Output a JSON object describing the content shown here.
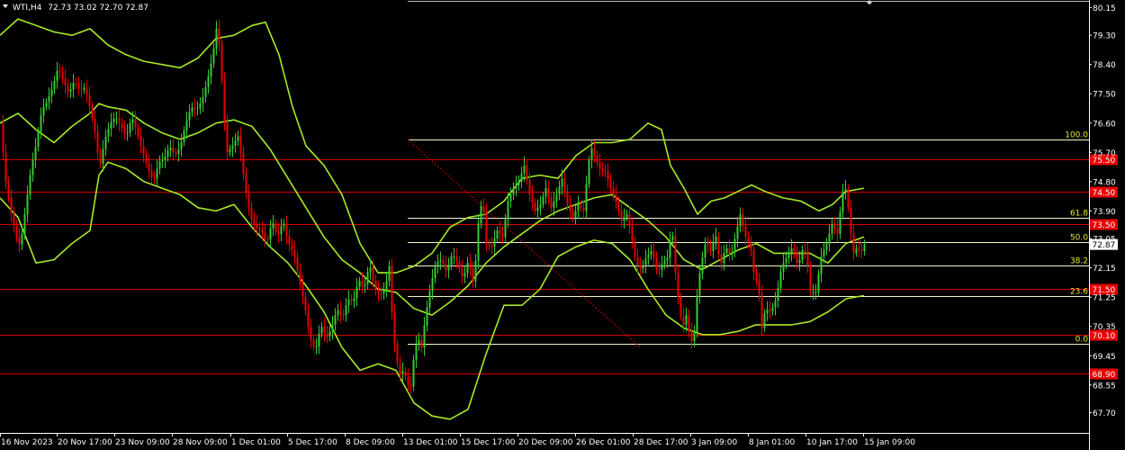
{
  "chart_data": {
    "type": "candlestick",
    "symbol_label": "WTI,H4",
    "ohlc_readout": "72.73 73.02 72.70 72.87",
    "ylim": [
      67.3,
      80.3
    ],
    "y_ticks": [
      "80.15",
      "79.30",
      "78.40",
      "77.50",
      "76.60",
      "75.70",
      "74.80",
      "73.90",
      "73.05",
      "72.15",
      "71.25",
      "70.35",
      "69.45",
      "68.55",
      "67.70"
    ],
    "x_ticks": [
      "16 Nov 2023",
      "20 Nov 17:00",
      "23 Nov 09:00",
      "28 Nov 09:00",
      "1 Dec 01:00",
      "5 Dec 17:00",
      "8 Dec 09:00",
      "13 Dec 01:00",
      "15 Dec 17:00",
      "20 Dec 09:00",
      "26 Dec 01:00",
      "28 Dec 17:00",
      "3 Jan 09:00",
      "8 Jan 01:00",
      "10 Jan 17:00",
      "15 Jan 09:00"
    ],
    "current_price": "72.87",
    "horizontal_levels": [
      "75.50",
      "74.50",
      "73.50",
      "71.50",
      "70.10",
      "68.90"
    ],
    "fibonacci": [
      {
        "label": "100.0",
        "price": 76.09
      },
      {
        "label": "61.8",
        "price": 73.69
      },
      {
        "label": "50.0",
        "price": 72.95
      },
      {
        "label": "38.2",
        "price": 72.21
      },
      {
        "label": "23.6",
        "price": 71.29
      },
      {
        "label": "0.0",
        "price": 69.81
      }
    ],
    "price_path": [
      [
        0,
        76.6
      ],
      [
        6,
        74.8
      ],
      [
        12,
        73.8
      ],
      [
        18,
        73.1
      ],
      [
        22,
        72.8
      ],
      [
        28,
        74.0
      ],
      [
        34,
        75.2
      ],
      [
        40,
        76.0
      ],
      [
        46,
        77.0
      ],
      [
        52,
        77.3
      ],
      [
        58,
        77.7
      ],
      [
        64,
        78.3
      ],
      [
        70,
        77.9
      ],
      [
        76,
        77.5
      ],
      [
        82,
        77.9
      ],
      [
        88,
        77.6
      ],
      [
        94,
        77.7
      ],
      [
        100,
        77.0
      ],
      [
        106,
        76.2
      ],
      [
        110,
        75.2
      ],
      [
        116,
        76.1
      ],
      [
        122,
        76.6
      ],
      [
        128,
        76.8
      ],
      [
        134,
        76.5
      ],
      [
        140,
        76.2
      ],
      [
        146,
        76.8
      ],
      [
        152,
        76.3
      ],
      [
        158,
        75.7
      ],
      [
        164,
        75.2
      ],
      [
        170,
        74.8
      ],
      [
        176,
        75.4
      ],
      [
        182,
        75.5
      ],
      [
        188,
        75.9
      ],
      [
        194,
        75.6
      ],
      [
        200,
        75.9
      ],
      [
        206,
        76.6
      ],
      [
        212,
        77.1
      ],
      [
        218,
        77.0
      ],
      [
        224,
        77.3
      ],
      [
        230,
        77.9
      ],
      [
        236,
        78.7
      ],
      [
        240,
        79.5
      ],
      [
        244,
        78.9
      ],
      [
        248,
        76.9
      ],
      [
        252,
        75.7
      ],
      [
        258,
        75.9
      ],
      [
        264,
        76.2
      ],
      [
        268,
        75.5
      ],
      [
        272,
        74.6
      ],
      [
        278,
        73.7
      ],
      [
        284,
        73.4
      ],
      [
        290,
        73.3
      ],
      [
        296,
        72.9
      ],
      [
        302,
        73.6
      ],
      [
        308,
        73.1
      ],
      [
        314,
        73.6
      ],
      [
        320,
        72.9
      ],
      [
        326,
        72.6
      ],
      [
        332,
        71.8
      ],
      [
        338,
        71.0
      ],
      [
        344,
        70.0
      ],
      [
        350,
        69.6
      ],
      [
        356,
        70.4
      ],
      [
        362,
        70.0
      ],
      [
        368,
        70.3
      ],
      [
        374,
        70.9
      ],
      [
        380,
        70.6
      ],
      [
        386,
        71.2
      ],
      [
        392,
        71.1
      ],
      [
        398,
        71.8
      ],
      [
        404,
        71.5
      ],
      [
        410,
        72.3
      ],
      [
        416,
        71.5
      ],
      [
        422,
        71.3
      ],
      [
        428,
        71.6
      ],
      [
        432,
        72.2
      ],
      [
        436,
        70.3
      ],
      [
        440,
        69.3
      ],
      [
        444,
        68.9
      ],
      [
        448,
        69.0
      ],
      [
        452,
        68.6
      ],
      [
        456,
        68.5
      ],
      [
        460,
        69.6
      ],
      [
        464,
        70.0
      ],
      [
        468,
        69.7
      ],
      [
        472,
        70.6
      ],
      [
        478,
        71.6
      ],
      [
        484,
        72.3
      ],
      [
        490,
        72.4
      ],
      [
        496,
        72.0
      ],
      [
        502,
        72.6
      ],
      [
        508,
        72.3
      ],
      [
        514,
        71.8
      ],
      [
        520,
        72.4
      ],
      [
        526,
        71.6
      ],
      [
        532,
        73.9
      ],
      [
        536,
        74.2
      ],
      [
        540,
        72.9
      ],
      [
        546,
        72.8
      ],
      [
        552,
        73.3
      ],
      [
        558,
        73.1
      ],
      [
        564,
        74.2
      ],
      [
        570,
        74.6
      ],
      [
        576,
        74.8
      ],
      [
        582,
        75.3
      ],
      [
        588,
        74.4
      ],
      [
        594,
        73.9
      ],
      [
        600,
        74.1
      ],
      [
        606,
        74.6
      ],
      [
        612,
        74.0
      ],
      [
        618,
        74.4
      ],
      [
        624,
        74.9
      ],
      [
        630,
        74.1
      ],
      [
        636,
        73.7
      ],
      [
        642,
        74.1
      ],
      [
        648,
        73.9
      ],
      [
        652,
        75.0
      ],
      [
        656,
        75.9
      ],
      [
        660,
        75.6
      ],
      [
        666,
        75.2
      ],
      [
        672,
        75.1
      ],
      [
        678,
        74.6
      ],
      [
        684,
        74.2
      ],
      [
        690,
        73.6
      ],
      [
        696,
        73.8
      ],
      [
        700,
        73.3
      ],
      [
        706,
        72.3
      ],
      [
        712,
        72.1
      ],
      [
        718,
        72.5
      ],
      [
        724,
        72.7
      ],
      [
        730,
        72.0
      ],
      [
        736,
        72.3
      ],
      [
        742,
        72.5
      ],
      [
        746,
        73.5
      ],
      [
        750,
        72.0
      ],
      [
        754,
        71.0
      ],
      [
        758,
        70.3
      ],
      [
        762,
        70.7
      ],
      [
        766,
        70.0
      ],
      [
        770,
        69.8
      ],
      [
        774,
        71.3
      ],
      [
        778,
        72.2
      ],
      [
        784,
        73.0
      ],
      [
        790,
        72.6
      ],
      [
        794,
        73.3
      ],
      [
        800,
        72.2
      ],
      [
        806,
        72.8
      ],
      [
        812,
        72.5
      ],
      [
        818,
        73.3
      ],
      [
        822,
        73.8
      ],
      [
        828,
        73.1
      ],
      [
        834,
        72.7
      ],
      [
        838,
        71.8
      ],
      [
        842,
        71.7
      ],
      [
        846,
        70.3
      ],
      [
        850,
        70.9
      ],
      [
        856,
        70.8
      ],
      [
        862,
        71.2
      ],
      [
        868,
        72.2
      ],
      [
        874,
        72.5
      ],
      [
        880,
        72.8
      ],
      [
        886,
        72.2
      ],
      [
        892,
        72.8
      ],
      [
        896,
        72.5
      ],
      [
        900,
        71.4
      ],
      [
        906,
        71.4
      ],
      [
        912,
        72.5
      ],
      [
        918,
        72.9
      ],
      [
        924,
        73.5
      ],
      [
        930,
        73.2
      ],
      [
        936,
        74.5
      ],
      [
        940,
        74.6
      ],
      [
        944,
        73.4
      ],
      [
        948,
        72.6
      ],
      [
        952,
        72.8
      ],
      [
        956,
        72.6
      ],
      [
        960,
        72.87
      ]
    ],
    "bands_upper": [
      [
        0,
        79.3
      ],
      [
        20,
        79.8
      ],
      [
        40,
        79.6
      ],
      [
        60,
        79.4
      ],
      [
        80,
        79.3
      ],
      [
        100,
        79.5
      ],
      [
        120,
        79.0
      ],
      [
        140,
        78.7
      ],
      [
        160,
        78.5
      ],
      [
        180,
        78.4
      ],
      [
        200,
        78.3
      ],
      [
        220,
        78.6
      ],
      [
        240,
        79.2
      ],
      [
        260,
        79.3
      ],
      [
        280,
        79.6
      ],
      [
        295,
        79.7
      ],
      [
        310,
        78.7
      ],
      [
        325,
        77.1
      ],
      [
        340,
        75.9
      ],
      [
        360,
        75.3
      ],
      [
        380,
        74.4
      ],
      [
        400,
        72.9
      ],
      [
        420,
        72.0
      ],
      [
        440,
        72.0
      ],
      [
        460,
        72.2
      ],
      [
        480,
        72.6
      ],
      [
        500,
        73.4
      ],
      [
        520,
        73.7
      ],
      [
        540,
        73.8
      ],
      [
        560,
        74.2
      ],
      [
        580,
        74.9
      ],
      [
        600,
        75.0
      ],
      [
        620,
        74.9
      ],
      [
        640,
        75.6
      ],
      [
        660,
        76.0
      ],
      [
        680,
        76.0
      ],
      [
        700,
        76.1
      ],
      [
        720,
        76.6
      ],
      [
        735,
        76.4
      ],
      [
        745,
        75.3
      ],
      [
        760,
        74.6
      ],
      [
        775,
        73.8
      ],
      [
        790,
        74.2
      ],
      [
        805,
        74.3
      ],
      [
        820,
        74.5
      ],
      [
        835,
        74.7
      ],
      [
        850,
        74.5
      ],
      [
        870,
        74.3
      ],
      [
        890,
        74.2
      ],
      [
        910,
        73.9
      ],
      [
        925,
        74.1
      ],
      [
        940,
        74.5
      ],
      [
        960,
        74.6
      ]
    ],
    "bands_middle": [
      [
        0,
        76.6
      ],
      [
        20,
        76.9
      ],
      [
        40,
        76.4
      ],
      [
        60,
        76.0
      ],
      [
        80,
        76.5
      ],
      [
        100,
        76.9
      ],
      [
        110,
        77.2
      ],
      [
        120,
        77.1
      ],
      [
        140,
        77.0
      ],
      [
        160,
        76.6
      ],
      [
        180,
        76.3
      ],
      [
        200,
        76.1
      ],
      [
        220,
        76.3
      ],
      [
        240,
        76.6
      ],
      [
        260,
        76.7
      ],
      [
        280,
        76.5
      ],
      [
        300,
        75.8
      ],
      [
        320,
        74.9
      ],
      [
        340,
        74.0
      ],
      [
        360,
        73.1
      ],
      [
        380,
        72.4
      ],
      [
        400,
        72.0
      ],
      [
        420,
        71.5
      ],
      [
        440,
        71.4
      ],
      [
        460,
        70.9
      ],
      [
        480,
        70.7
      ],
      [
        500,
        71.1
      ],
      [
        520,
        71.6
      ],
      [
        540,
        72.3
      ],
      [
        560,
        72.8
      ],
      [
        580,
        73.2
      ],
      [
        600,
        73.6
      ],
      [
        620,
        73.9
      ],
      [
        640,
        74.1
      ],
      [
        660,
        74.3
      ],
      [
        680,
        74.4
      ],
      [
        700,
        74.0
      ],
      [
        720,
        73.6
      ],
      [
        740,
        73.1
      ],
      [
        760,
        72.4
      ],
      [
        780,
        72.1
      ],
      [
        800,
        72.4
      ],
      [
        820,
        72.7
      ],
      [
        840,
        72.9
      ],
      [
        860,
        72.6
      ],
      [
        880,
        72.6
      ],
      [
        900,
        72.6
      ],
      [
        920,
        72.3
      ],
      [
        940,
        72.9
      ],
      [
        960,
        73.1
      ]
    ],
    "bands_lower": [
      [
        0,
        74.3
      ],
      [
        20,
        73.7
      ],
      [
        40,
        72.3
      ],
      [
        60,
        72.4
      ],
      [
        80,
        72.9
      ],
      [
        100,
        73.3
      ],
      [
        110,
        75.0
      ],
      [
        120,
        75.4
      ],
      [
        140,
        75.2
      ],
      [
        160,
        74.8
      ],
      [
        180,
        74.6
      ],
      [
        200,
        74.4
      ],
      [
        220,
        74.0
      ],
      [
        240,
        73.9
      ],
      [
        260,
        74.1
      ],
      [
        280,
        73.4
      ],
      [
        300,
        72.8
      ],
      [
        320,
        72.3
      ],
      [
        340,
        71.6
      ],
      [
        360,
        70.8
      ],
      [
        380,
        69.7
      ],
      [
        400,
        69.0
      ],
      [
        420,
        69.2
      ],
      [
        440,
        69.0
      ],
      [
        460,
        68.0
      ],
      [
        480,
        67.6
      ],
      [
        500,
        67.5
      ],
      [
        520,
        67.8
      ],
      [
        540,
        69.5
      ],
      [
        560,
        71.0
      ],
      [
        580,
        71.0
      ],
      [
        600,
        71.5
      ],
      [
        620,
        72.5
      ],
      [
        640,
        72.8
      ],
      [
        660,
        73.0
      ],
      [
        680,
        72.9
      ],
      [
        700,
        72.4
      ],
      [
        720,
        71.5
      ],
      [
        740,
        70.7
      ],
      [
        760,
        70.3
      ],
      [
        780,
        70.1
      ],
      [
        800,
        70.1
      ],
      [
        820,
        70.2
      ],
      [
        840,
        70.4
      ],
      [
        860,
        70.4
      ],
      [
        880,
        70.4
      ],
      [
        900,
        70.5
      ],
      [
        920,
        70.8
      ],
      [
        940,
        71.2
      ],
      [
        960,
        71.3
      ]
    ],
    "diagonal_from": [
      453,
      76.1
    ],
    "diagonal_to": [
      712,
      69.7
    ],
    "colors": {
      "background": "#000000",
      "bull": "#33cc33",
      "bear": "#e80000",
      "bands": "#a6ea26",
      "level_line": "#d40000",
      "level_tag_bg": "#e80000",
      "fib_line": "#f5f5c8",
      "fib_text": "#e8e833",
      "current_price_bg": "#ffffff",
      "axis_text": "#ffffff"
    }
  }
}
